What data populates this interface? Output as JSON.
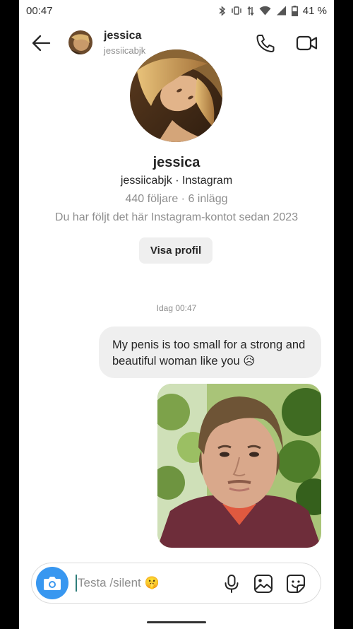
{
  "status_bar": {
    "time": "00:47",
    "battery": "41 %",
    "icons": [
      "bluetooth-icon",
      "vibrate-icon",
      "data-arrows-icon",
      "wifi-icon",
      "signal-icon",
      "battery-icon"
    ]
  },
  "header": {
    "name": "jessica",
    "username": "jessiicabjk",
    "icons": [
      "back-arrow-icon",
      "phone-icon",
      "video-camera-icon"
    ]
  },
  "profile": {
    "name": "jessica",
    "username": "jessiicabjk",
    "platform": "Instagram",
    "stats": "440 följare · 6 inlägg",
    "follow_info": "Du har följt det här Instagram-kontot sedan 2023",
    "button_label": "Visa profil"
  },
  "chat": {
    "timestamp": "Idag 00:47",
    "messages": [
      {
        "sender": "me",
        "type": "text",
        "text": "My penis is too small for a strong and beautiful woman like you 😥"
      },
      {
        "sender": "me",
        "type": "photo"
      }
    ]
  },
  "composer": {
    "placeholder": "Testa /silent 🤫",
    "icons": [
      "camera-icon",
      "microphone-icon",
      "gallery-icon",
      "sticker-icon"
    ]
  },
  "colors": {
    "accent": "#3897f0",
    "bubble": "#efefef",
    "secondary_text": "#8e8e8e",
    "primary_text": "#262626"
  }
}
